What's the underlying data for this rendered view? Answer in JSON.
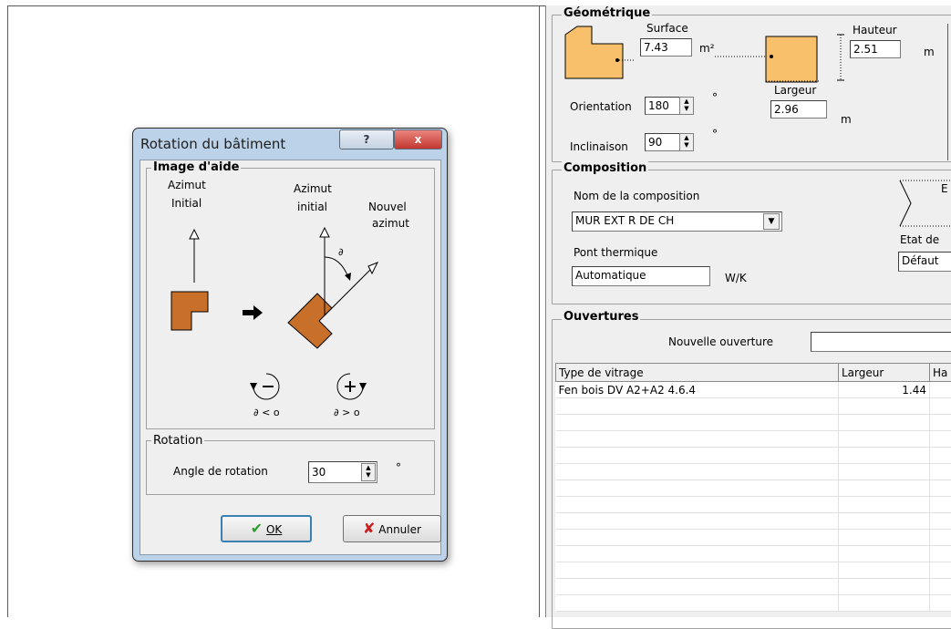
{
  "geometry": {
    "title": "Géométrique",
    "surface_label": "Surface",
    "surface_value": "7.43",
    "surface_unit": "m²",
    "height_label": "Hauteur",
    "height_value": "2.51",
    "height_unit": "m",
    "width_label": "Largeur",
    "width_value": "2.96",
    "width_unit": "m",
    "orientation_label": "Orientation",
    "orientation_value": "180",
    "orientation_unit": "°",
    "inclination_label": "Inclinaison",
    "inclination_value": "90",
    "inclination_unit": "°"
  },
  "composition": {
    "title": "Composition",
    "name_label": "Nom de la composition",
    "name_value": "MUR EXT  R DE CH",
    "thermal_bridge_label": "Pont thermique",
    "thermal_bridge_value": "Automatique",
    "thermal_bridge_unit": "W/K",
    "state_label": "Etat de",
    "state_value": "Défaut",
    "arrow_text": "E"
  },
  "openings": {
    "title": "Ouvertures",
    "new_opening_label": "Nouvelle ouverture",
    "columns": [
      "Type de vitrage",
      "Largeur",
      "Ha"
    ],
    "rows": [
      {
        "type": "Fen bois DV A2+A2 4.6.4",
        "largeur": "1.44",
        "hauteur": ""
      }
    ]
  },
  "dialog": {
    "title": "Rotation du bâtiment",
    "help_button": "?",
    "close_button": "x",
    "help_image_group": "Image d'aide",
    "azimut_initial_1": "Azimut",
    "azimut_initial_2": "Initial",
    "azimut_initial_b1": "Azimut",
    "azimut_initial_b2": "initial",
    "nouvel_azimut_1": "Nouvel",
    "nouvel_azimut_2": "azimut",
    "angle_symbol": "∂",
    "neg_rotation": "∂ < o",
    "pos_rotation": "∂ > o",
    "rotation_group": "Rotation",
    "angle_label": "Angle de rotation",
    "angle_value": "30",
    "angle_unit": "°",
    "ok_label": "OK",
    "cancel_label": "Annuler"
  },
  "colors": {
    "shape_fill": "#f9c06c",
    "brick_fill": "#c8702a",
    "ok_check": "#2e9e2e",
    "cancel_x": "#c81e1e",
    "close_button": "#c9403a"
  }
}
